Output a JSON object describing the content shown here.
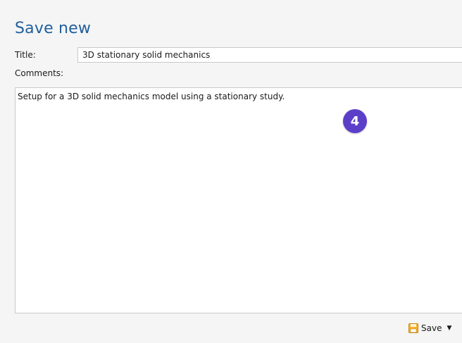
{
  "panel": {
    "heading": "Save new",
    "title_label": "Title:",
    "title_value": "3D stationary solid mechanics",
    "comments_label": "Comments:",
    "comments_value": "Setup for a 3D solid mechanics model using a stationary study.",
    "step_badge": "4",
    "save_label": "Save",
    "save_icon": "floppy-disk-icon",
    "dropdown_icon": "caret-down-icon"
  },
  "colors": {
    "heading": "#1f5f9e",
    "badge": "#5b3fc9",
    "save_icon": "#f0a020"
  }
}
